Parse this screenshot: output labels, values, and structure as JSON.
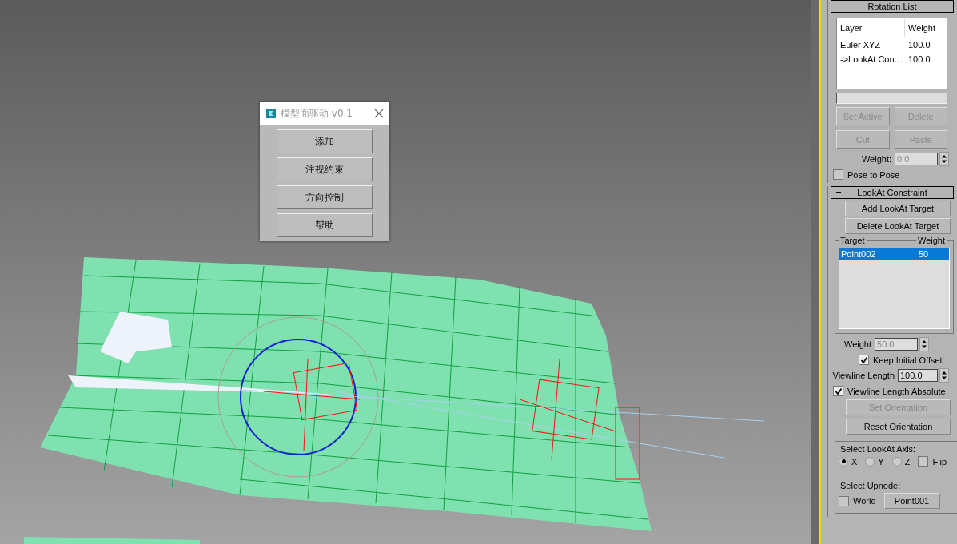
{
  "dialog": {
    "title": "模型面驱动 v0.1",
    "buttons": [
      "添加",
      "注视约束",
      "方向控制",
      "帮助"
    ]
  },
  "rotation_list": {
    "title": "Rotation List",
    "columns": [
      "Layer",
      "Weight"
    ],
    "rows": [
      {
        "layer": "Euler XYZ",
        "weight": "100.0"
      },
      {
        "layer": "->LookAt Con…",
        "weight": "100.0"
      }
    ],
    "buttons": [
      {
        "label": "Set Active",
        "disabled": true
      },
      {
        "label": "Delete",
        "disabled": true
      },
      {
        "label": "Cut",
        "disabled": true
      },
      {
        "label": "Paste",
        "disabled": true
      }
    ],
    "weight": {
      "label": "Weight:",
      "value": "0.0"
    },
    "pose_to_pose": {
      "label": "Pose to Pose",
      "checked": false
    }
  },
  "lookat_constraint": {
    "title": "LookAt Constraint",
    "buttons": [
      {
        "label": "Add LookAt Target",
        "disabled": false
      },
      {
        "label": "Delete LookAt Target",
        "disabled": false
      }
    ],
    "target_list": {
      "columns": [
        "Target",
        "Weight"
      ],
      "rows": [
        {
          "target": "Point002",
          "weight": "50",
          "selected": true
        }
      ]
    },
    "weight": {
      "label": "Weight",
      "value": "50.0"
    },
    "keep_initial_offset": {
      "label": "Keep Initial Offset",
      "checked": true
    },
    "viewline_length": {
      "label": "Viewline Length",
      "value": "100.0"
    },
    "viewline_length_absolute": {
      "label": "Viewline Length Absolute",
      "checked": true
    },
    "orientation_buttons": [
      {
        "label": "Set Orientation",
        "disabled": true
      },
      {
        "label": "Reset Orientation",
        "disabled": false
      }
    ],
    "lookat_axis": {
      "title": "Select LookAt Axis:",
      "options": [
        {
          "label": "X",
          "selected": true
        },
        {
          "label": "Y",
          "selected": false
        },
        {
          "label": "Z",
          "selected": false
        }
      ],
      "flip": {
        "label": "Flip",
        "checked": false
      }
    },
    "upnode": {
      "title": "Select Upnode:",
      "world": {
        "label": "World",
        "checked": false
      },
      "button": "Point001"
    }
  }
}
